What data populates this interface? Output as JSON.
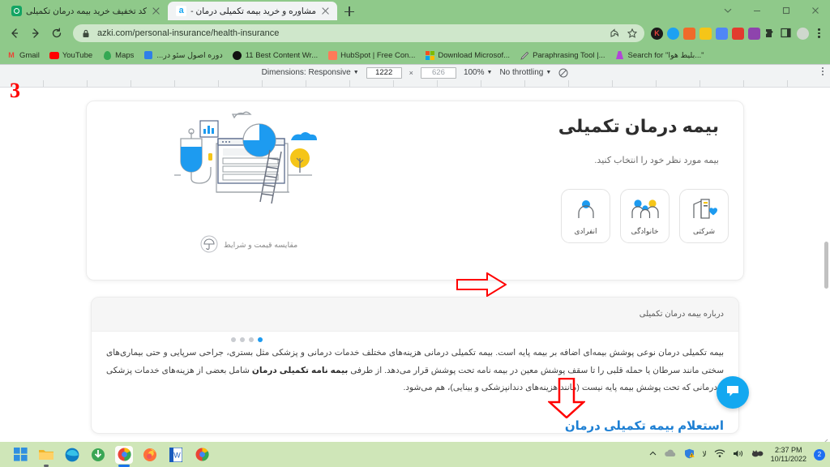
{
  "browser": {
    "tabs": [
      {
        "title": "کد تخفیف خرید بیمه درمان تکمیلی",
        "favicon": "green-circle-icon",
        "active": false
      },
      {
        "title": "مشاوره و خرید بیمه تکمیلی درمان -",
        "favicon": "azki-icon",
        "active": true
      }
    ],
    "new_tab_label": "+",
    "window_controls": [
      "minimize-to-tray",
      "minimize",
      "maximize",
      "close"
    ],
    "url": "azki.com/personal-insurance/health-insurance",
    "nav": {
      "back": "←",
      "forward": "→",
      "reload": "C"
    },
    "bookmarks": [
      {
        "label": "Gmail",
        "icon": "gmail-icon"
      },
      {
        "label": "YouTube",
        "icon": "youtube-icon"
      },
      {
        "label": "Maps",
        "icon": "maps-icon"
      },
      {
        "label": "دوره اصول سئو در...",
        "icon": "blue-doc-icon"
      },
      {
        "label": "11 Best Content Wr...",
        "icon": "globe-icon"
      },
      {
        "label": "HubSpot | Free Con...",
        "icon": "hubspot-icon"
      },
      {
        "label": "Download Microsof...",
        "icon": "microsoft-icon"
      },
      {
        "label": "Paraphrasing Tool |...",
        "icon": "pen-icon"
      },
      {
        "label": "Search for \"بلیط هوا...\"",
        "icon": "search-icon"
      }
    ],
    "extensions": [
      "k-extension-icon",
      "blue-check-extension-icon",
      "analytics-extension-icon",
      "translate-de-extension-icon",
      "rocket-extension-icon",
      "seo-extension-icon",
      "purple-extension-icon",
      "puzzle-extension-icon",
      "reading-list-icon"
    ],
    "profile": "avatar",
    "menu": "three-dot-menu-icon"
  },
  "devtools": {
    "dimensions_label": "Dimensions: Responsive",
    "width": "1222",
    "height": "626",
    "zoom": "100%",
    "throttling": "No throttling",
    "rotate_icon": "rotate-icon",
    "more_icon": "three-dot-menu-icon"
  },
  "page": {
    "hero": {
      "title": "بیمه درمان تکمیلی",
      "subtitle": "بیمه مورد نظر خود را انتخاب کنید.",
      "types": [
        {
          "label": "شرکتی",
          "icon": "building-heart-icon"
        },
        {
          "label": "خانوادگی",
          "icon": "family-icon"
        },
        {
          "label": "انفرادی",
          "icon": "person-icon"
        }
      ],
      "illustration_caption": "مقایسه قیمت و شرایط",
      "illustration_icon": "umbrella-icon",
      "carousel_dots": 4,
      "carousel_active_index": 3
    },
    "about": {
      "header": "درباره بیمه درمان تکمیلی",
      "paragraph_part1": "بیمه تکمیلی درمان نوعی پوشش بیمه‌ای اضافه بر بیمه پایه است. بیمه تکمیلی درمانی هزینه‌های مختلف خدمات درمانی و پزشکی مثل بستری، جراحی سرپایی و حتی بیماری‌های سختی مانند سرطان یا حمله قلبی را تا سقف پوشش معین در بیمه نامه تحت پوشش قرار می‌دهد. از طرفی ",
      "paragraph_bold": "بیمه نامه تکمیلی درمان",
      "paragraph_part2": " شامل بعضی از هزینه‌های خدمات پزشکی و درمانی که تحت پوشش بیمه پایه نیست (مانند هزینه‌های دندانپزشکی و بینایی)، هم می‌شود.",
      "sub_title": "استعلام بیمه تکمیلی درمان"
    },
    "chat_button_icon": "chat-bubble-icon",
    "annotations": {
      "step_number": "3",
      "arrow_right": "red-arrow-right",
      "arrow_down": "red-arrow-down",
      "accent_color": "#ff0000"
    }
  },
  "taskbar": {
    "apps": [
      {
        "name": "start-button",
        "icon": "windows-logo-icon"
      },
      {
        "name": "file-explorer",
        "icon": "folder-icon"
      },
      {
        "name": "microsoft-edge",
        "icon": "edge-icon"
      },
      {
        "name": "internet-download-manager",
        "icon": "idm-icon"
      },
      {
        "name": "google-chrome",
        "icon": "chrome-icon"
      },
      {
        "name": "mozilla-firefox",
        "icon": "firefox-icon"
      },
      {
        "name": "microsoft-word",
        "icon": "word-icon"
      },
      {
        "name": "google-chrome-2",
        "icon": "chrome-icon"
      }
    ],
    "tray": {
      "show_hidden": "chevron-up-icon",
      "onedrive": "cloud-icon",
      "warning": "shield-warning-icon",
      "language": "لا",
      "wifi": "wifi-icon",
      "volume": "speaker-icon",
      "vpn": "vpn-icon",
      "time": "2:37 PM",
      "date": "10/11/2022",
      "notifications": "2"
    }
  }
}
